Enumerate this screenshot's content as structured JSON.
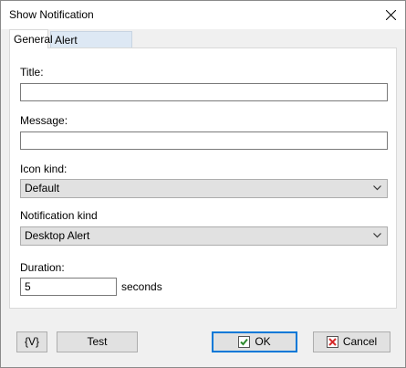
{
  "window": {
    "title": "Show Notification"
  },
  "tabs": [
    {
      "label": "General",
      "active": true
    },
    {
      "label": "Alert Parameters",
      "active": false
    }
  ],
  "form": {
    "title_label": "Title:",
    "title_value": "",
    "message_label": "Message:",
    "message_value": "",
    "icon_kind_label": "Icon kind:",
    "icon_kind_value": "Default",
    "notification_kind_label": "Notification kind",
    "notification_kind_value": "Desktop Alert",
    "duration_label": "Duration:",
    "duration_value": "5",
    "duration_unit": "seconds"
  },
  "buttons": {
    "variables": "{V}",
    "test": "Test",
    "ok": "OK",
    "cancel": "Cancel"
  },
  "colors": {
    "ok_icon": "#2e8b2e",
    "cancel_icon": "#d62b2b",
    "focus_border": "#0078d7"
  }
}
